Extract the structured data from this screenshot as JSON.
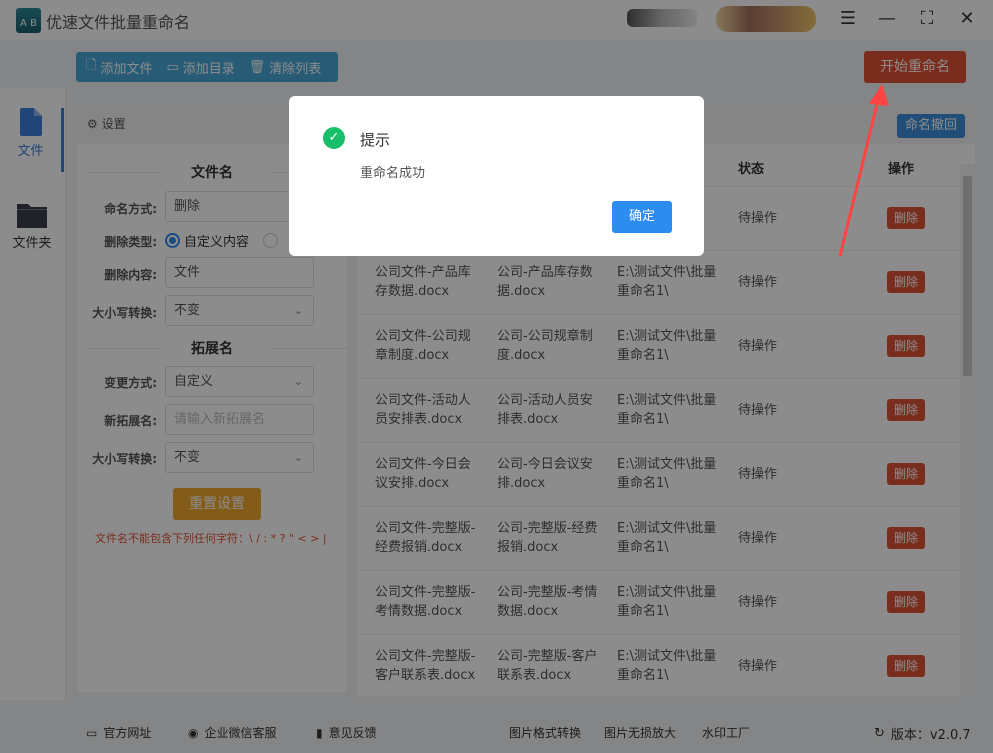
{
  "app": {
    "title": "优速文件批量重命名",
    "logo_text": "AB"
  },
  "window_controls": [
    "menu-icon",
    "minimize-icon",
    "maximize-icon",
    "close-icon"
  ],
  "toolbar": {
    "add_file": "添加文件",
    "add_folder": "添加目录",
    "clear_list": "清除列表",
    "start": "开始重命名"
  },
  "sidebar": {
    "items": [
      {
        "label": "文件",
        "icon": "file-icon",
        "active": true
      },
      {
        "label": "文件夹",
        "icon": "folder-icon",
        "active": false
      }
    ]
  },
  "settings": {
    "title": "设置",
    "filename_section": "文件名",
    "naming_mode_label": "命名方式:",
    "naming_mode_value": "删除",
    "delete_type_label": "删除类型:",
    "delete_type_option": "自定义内容",
    "delete_content_label": "删除内容:",
    "delete_content_value": "文件",
    "case_label": "大小写转换:",
    "case_value": "不变",
    "ext_section": "拓展名",
    "change_mode_label": "变更方式:",
    "change_mode_value": "自定义",
    "new_ext_label": "新拓展名:",
    "new_ext_placeholder": "请输入新拓展名",
    "ext_case_label": "大小写转换:",
    "ext_case_value": "不变",
    "reset": "重置设置",
    "warning": "文件名不能包含下列任何字符：\\ / : * ? \" < > |"
  },
  "table": {
    "undo": "命名撤回",
    "headers": {
      "status": "状态",
      "action": "操作"
    },
    "rows": [
      {
        "original": "",
        "new": "",
        "path": "",
        "status": "待操作",
        "action": "删除"
      },
      {
        "original": "公司文件-产品库存数据.docx",
        "new": "公司-产品库存数据.docx",
        "path": "E:\\测试文件\\批量重命名1\\",
        "status": "待操作",
        "action": "删除"
      },
      {
        "original": "公司文件-公司规章制度.docx",
        "new": "公司-公司规章制度.docx",
        "path": "E:\\测试文件\\批量重命名1\\",
        "status": "待操作",
        "action": "删除"
      },
      {
        "original": "公司文件-活动人员安排表.docx",
        "new": "公司-活动人员安排表.docx",
        "path": "E:\\测试文件\\批量重命名1\\",
        "status": "待操作",
        "action": "删除"
      },
      {
        "original": "公司文件-今日会议安排.docx",
        "new": "公司-今日会议安排.docx",
        "path": "E:\\测试文件\\批量重命名1\\",
        "status": "待操作",
        "action": "删除"
      },
      {
        "original": "公司文件-完整版-经费报销.docx",
        "new": "公司-完整版-经费报销.docx",
        "path": "E:\\测试文件\\批量重命名1\\",
        "status": "待操作",
        "action": "删除"
      },
      {
        "original": "公司文件-完整版-考情数据.docx",
        "new": "公司-完整版-考情数据.docx",
        "path": "E:\\测试文件\\批量重命名1\\",
        "status": "待操作",
        "action": "删除"
      },
      {
        "original": "公司文件-完整版-客户联系表.docx",
        "new": "公司-完整版-客户联系表.docx",
        "path": "E:\\测试文件\\批量重命名1\\",
        "status": "待操作",
        "action": "删除"
      }
    ]
  },
  "footer": {
    "website": "官方网址",
    "wechat": "企业微信客服",
    "feedback": "意见反馈",
    "link1": "图片格式转换",
    "link2": "图片无损放大",
    "link3": "水印工厂",
    "version": "版本：v2.0.7"
  },
  "dialog": {
    "title": "提示",
    "message": "重命名成功",
    "ok": "确定",
    "icon": "success-check-icon"
  },
  "colors": {
    "start": "#e05235",
    "primary": "#2d8cf0",
    "success": "#19be6b",
    "toolbar": "#4aa8d8",
    "reset": "#f0a830",
    "annotation_arrow": "#ff4444"
  }
}
